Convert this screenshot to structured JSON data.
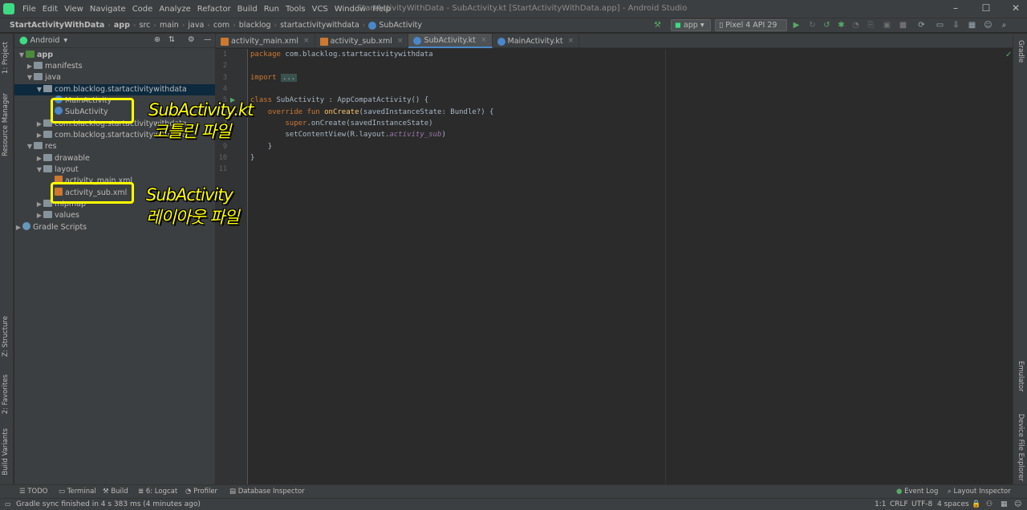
{
  "window": {
    "title": "StartActivityWithData - SubActivity.kt [StartActivityWithData.app] - Android Studio",
    "menu": [
      "File",
      "Edit",
      "View",
      "Navigate",
      "Code",
      "Analyze",
      "Refactor",
      "Build",
      "Run",
      "Tools",
      "VCS",
      "Window",
      "Help"
    ]
  },
  "breadcrumb": [
    "StartActivityWithData",
    "app",
    "src",
    "main",
    "java",
    "com",
    "blacklog",
    "startactivitywithdata",
    "SubActivity"
  ],
  "toolbar": {
    "run_config": "app",
    "device": "Pixel 4 API 29"
  },
  "left_tabs": {
    "project": "1: Project",
    "resource_manager": "Resource Manager",
    "structure": "Z: Structure",
    "favorites": "2: Favorites",
    "build_variants": "Build Variants"
  },
  "right_tabs": {
    "gradle": "Gradle",
    "emulator": "Emulator",
    "device_explorer": "Device File Explorer"
  },
  "project_panel": {
    "view_mode": "Android",
    "tree": {
      "app": "app",
      "manifests": "manifests",
      "java": "java",
      "pkg_main": "com.blacklog.startactivitywithdata",
      "main_activity": "MainActivity",
      "sub_activity": "SubActivity",
      "pkg_android_test": "com.blacklog.startactivitywithdata",
      "pkg_test": "com.blacklog.startactivitywithdata",
      "res": "res",
      "drawable": "drawable",
      "layout": "layout",
      "layout_main": "activity_main.xml",
      "layout_sub": "activity_sub.xml",
      "mipmap": "mipmap",
      "values": "values",
      "gradle_scripts": "Gradle Scripts"
    }
  },
  "editor_tabs": [
    {
      "label": "activity_main.xml"
    },
    {
      "label": "activity_sub.xml"
    },
    {
      "label": "SubActivity.kt"
    },
    {
      "label": "MainActivity.kt"
    }
  ],
  "code": {
    "line_numbers": [
      "1",
      "2",
      "3",
      "4",
      "5",
      "6",
      "7",
      "8",
      "9",
      "10",
      "11"
    ],
    "l1_kw": "package",
    "l1_rest": " com.blacklog.startactivitywithdata",
    "l3_kw": "import",
    "l3_fold": "...",
    "l5_kw": "class",
    "l5_rest": " SubActivity : AppCompatActivity() {",
    "l6_kw": "override fun",
    "l6_fn": " onCreate",
    "l6_rest": "(savedInstanceState: Bundle?) {",
    "l7_kw": "super",
    "l7_rest": ".onCreate(savedInstanceState)",
    "l8_pre": "setContentView(R.layout.",
    "l8_it": "activity_sub",
    "l8_post": ")",
    "l9": "}",
    "l10": "}"
  },
  "bottom_tools": [
    "TODO",
    "Terminal",
    "Build",
    "6: Logcat",
    "Profiler",
    "Database Inspector"
  ],
  "bottom_right_tools": [
    "Event Log",
    "Layout Inspector"
  ],
  "status": {
    "message": "Gradle sync finished in 4 s 383 ms (4 minutes ago)",
    "position": "1:1",
    "line_sep": "CRLF",
    "encoding": "UTF-8",
    "indent": "4 spaces"
  },
  "annotations": {
    "kt_title": "SubActivity.kt",
    "kt_sub": "코틀린 파일",
    "layout_title": "SubActivity",
    "layout_sub": "레이아웃 파일"
  },
  "colors": {
    "highlight": "#ffff00",
    "selection": "#0d293e",
    "editor_bg": "#2b2b2b"
  }
}
